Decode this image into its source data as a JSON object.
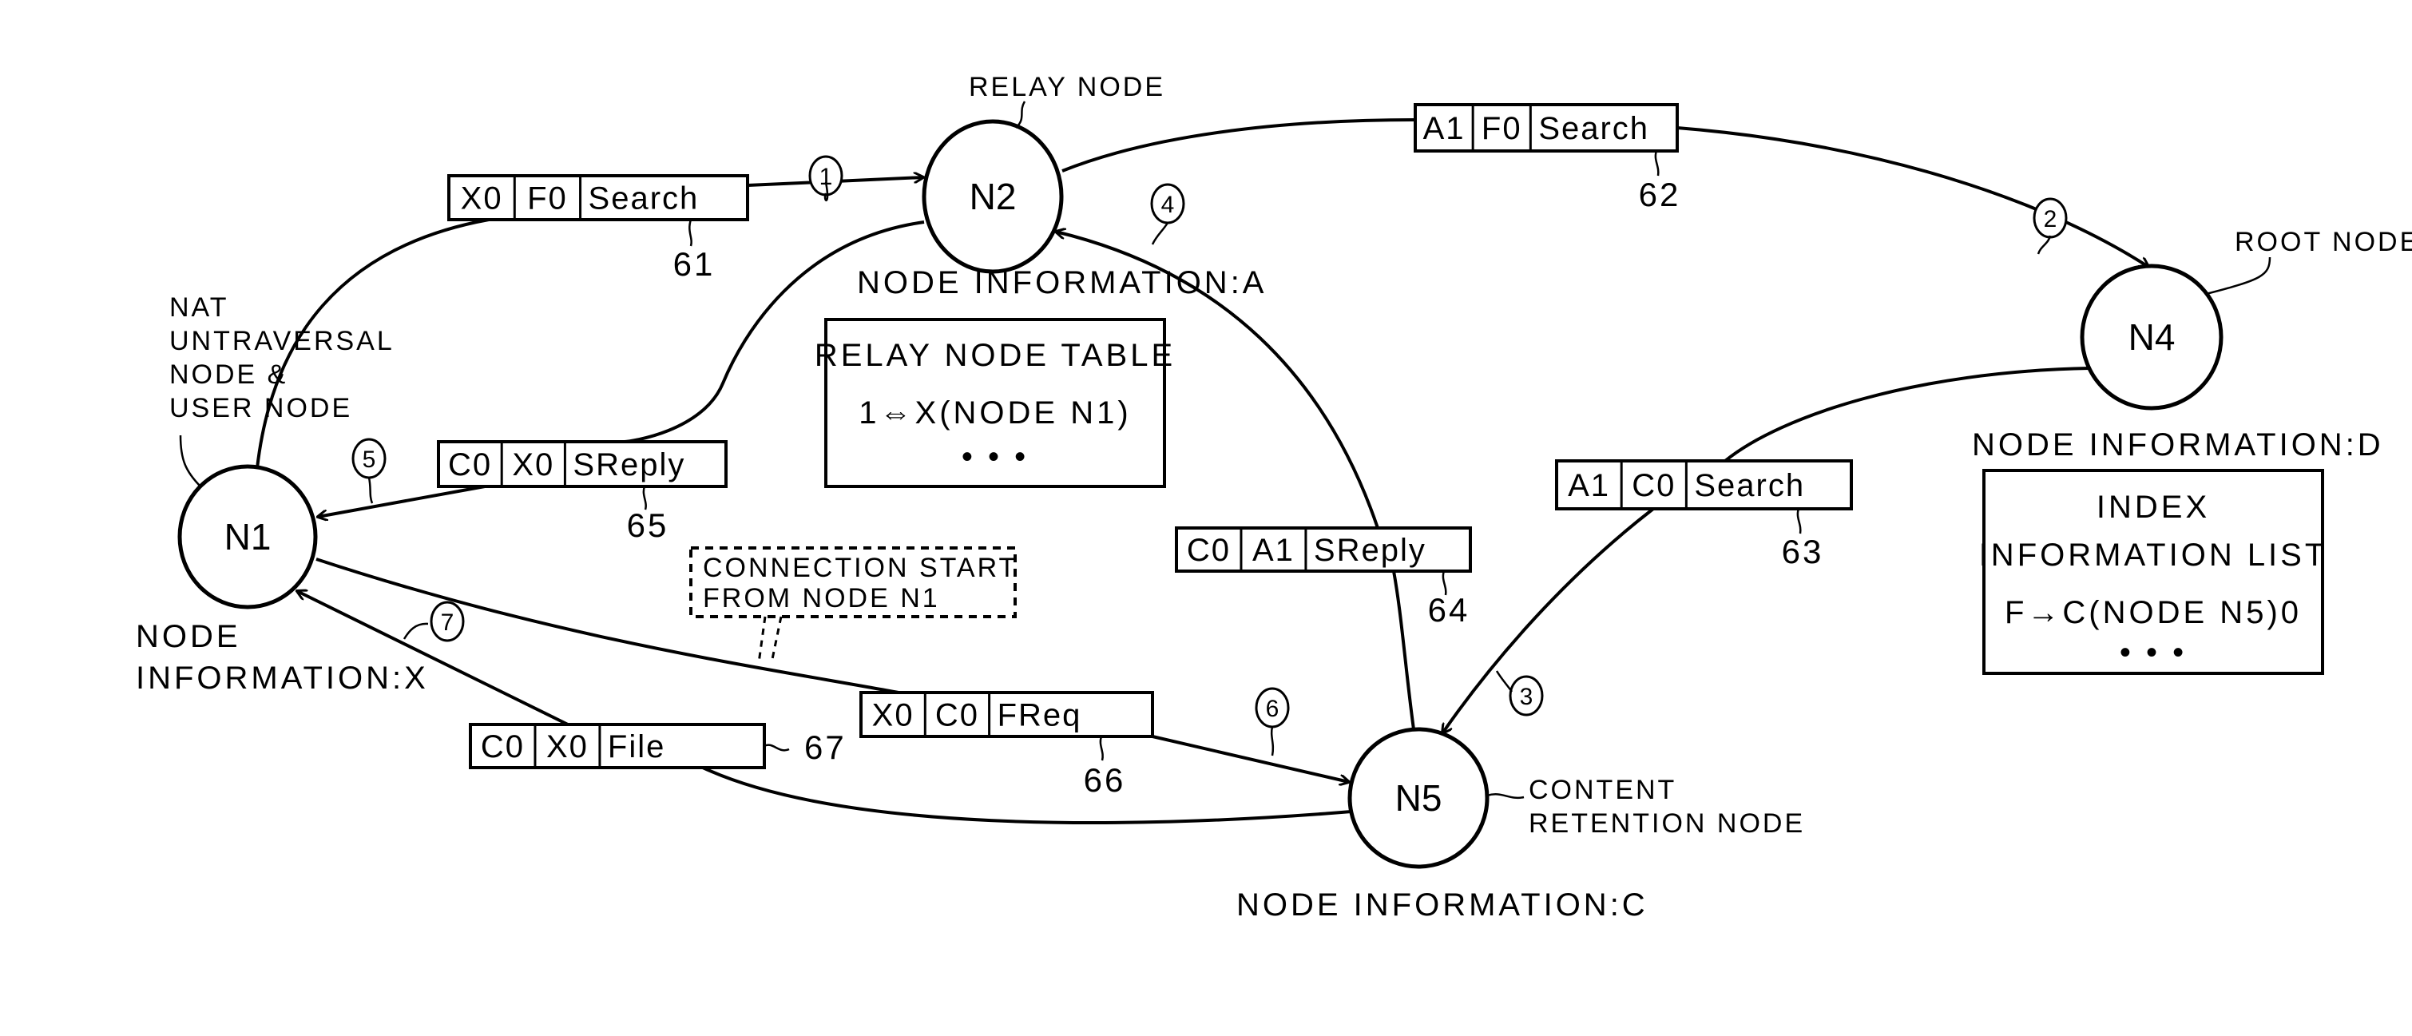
{
  "nodes": [
    {
      "id": "N1",
      "label": "N1",
      "role": "NAT\nUNTRAVERSAL\nNODE &\nUSER NODE",
      "info": "NODE\nINFORMATION:X"
    },
    {
      "id": "N2",
      "label": "N2",
      "role": "RELAY NODE",
      "info": "NODE INFORMATION:A"
    },
    {
      "id": "N4",
      "label": "N4",
      "role": "ROOT NODE",
      "info": "NODE INFORMATION:D"
    },
    {
      "id": "N5",
      "label": "N5",
      "role": "CONTENT\nRETENTION NODE",
      "info": "NODE INFORMATION:C"
    }
  ],
  "tables": {
    "relay": {
      "title": "RELAY NODE TABLE",
      "rows": [
        "1⇔X(NODE N1)",
        "• • •"
      ]
    },
    "index": {
      "title_lines": [
        "INDEX",
        "INFORMATION LIST"
      ],
      "rows": [
        "F→C(NODE N5)0",
        "• • •"
      ]
    }
  },
  "messages": [
    {
      "ref": "61",
      "step": "1",
      "cells": [
        "X0",
        "F0",
        "Search"
      ]
    },
    {
      "ref": "62",
      "step": "2",
      "cells": [
        "A1",
        "F0",
        "Search"
      ]
    },
    {
      "ref": "63",
      "step": "3",
      "cells": [
        "A1",
        "C0",
        "Search"
      ]
    },
    {
      "ref": "64",
      "step": "4",
      "cells": [
        "C0",
        "A1",
        "SReply"
      ]
    },
    {
      "ref": "65",
      "step": "5",
      "cells": [
        "C0",
        "X0",
        "SReply"
      ]
    },
    {
      "ref": "66",
      "step": "6",
      "cells": [
        "X0",
        "C0",
        "FReq"
      ]
    },
    {
      "ref": "67",
      "step": "7",
      "cells": [
        "C0",
        "X0",
        "File"
      ]
    }
  ],
  "callout": {
    "lines": [
      "CONNECTION START",
      "FROM NODE N1"
    ]
  },
  "colors": {
    "ink": "#000000",
    "paper": "#ffffff"
  }
}
